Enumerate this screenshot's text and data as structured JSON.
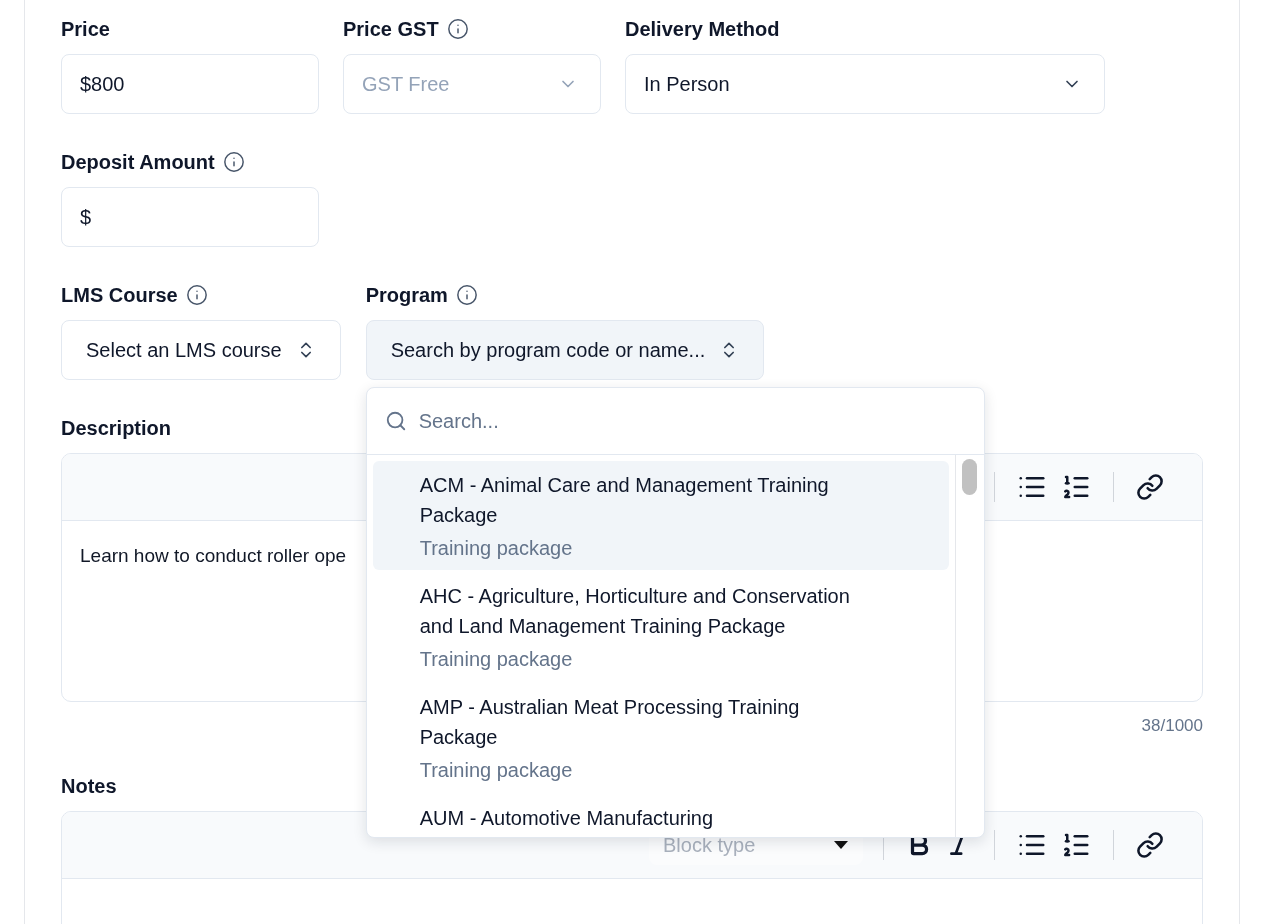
{
  "row1": [
    {
      "label": "Price",
      "info": false,
      "kind": "input",
      "value": "$800",
      "disabled": false
    },
    {
      "label": "Price GST",
      "info": true,
      "kind": "select",
      "value": "GST Free",
      "disabled": true
    },
    {
      "label": "Delivery Method",
      "info": false,
      "kind": "select",
      "value": "In Person",
      "disabled": false
    }
  ],
  "deposit": {
    "label": "Deposit Amount",
    "info": true,
    "value": "$"
  },
  "lms_course": {
    "label": "LMS Course",
    "info": true,
    "placeholder": "Select an LMS course"
  },
  "program": {
    "label": "Program",
    "info": true,
    "placeholder": "Search by program code or name...",
    "open": true,
    "menu": {
      "search_placeholder": "Search...",
      "options": [
        {
          "title": "ACM - Animal Care and Management Training Package",
          "subtitle": "Training package",
          "selected": true
        },
        {
          "title": "AHC - Agriculture, Horticulture and Conservation and Land Management Training Package",
          "subtitle": "Training package",
          "selected": false
        },
        {
          "title": "AMP - Australian Meat Processing Training Package",
          "subtitle": "Training package",
          "selected": false
        },
        {
          "title": "AUM - Automotive Manufacturing",
          "selected": false
        }
      ]
    }
  },
  "description": {
    "label": "Description",
    "text": "Learn how to conduct roller ope",
    "counter": "38/1000",
    "tool_groups": [
      [
        {
          "kind": "bullet-list"
        },
        {
          "kind": "numbered-list"
        }
      ],
      [
        {
          "kind": "link"
        }
      ]
    ]
  },
  "notes": {
    "label": "Notes",
    "tool_groups": [
      [
        {
          "kind": "block-type",
          "placeholder": "Block type"
        }
      ],
      [
        {
          "kind": "bold"
        },
        {
          "kind": "italic"
        }
      ],
      [
        {
          "kind": "bullet-list"
        },
        {
          "kind": "numbered-list"
        }
      ],
      [
        {
          "kind": "link"
        }
      ]
    ]
  }
}
